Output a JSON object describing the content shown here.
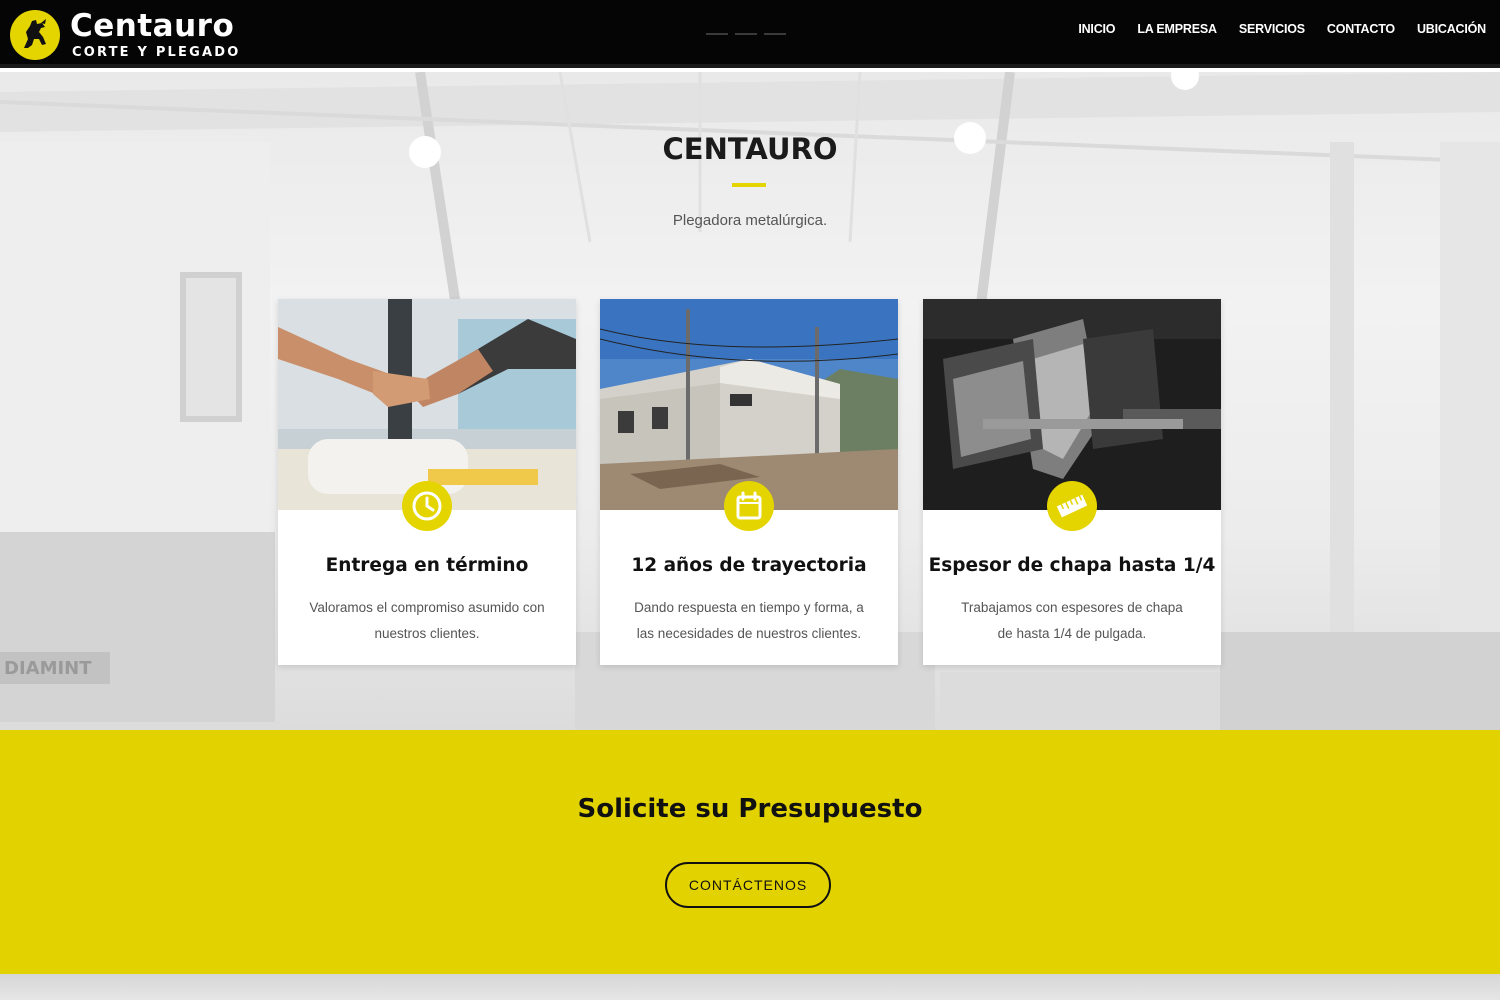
{
  "header": {
    "brand": "Centauro",
    "tagline": "CORTE Y PLEGADO",
    "nav": [
      "INICIO",
      "LA EMPRESA",
      "SERVICIOS",
      "CONTACTO",
      "UBICACIÓN"
    ]
  },
  "hero": {
    "title": "CENTAURO",
    "subtitle": "Plegadora metalúrgica.",
    "bg_watermark": "DIAMINT"
  },
  "features": [
    {
      "icon": "clock-icon",
      "title": "Entrega en término",
      "text": "Valoramos el compromiso asumido con nuestros clientes."
    },
    {
      "icon": "calendar-icon",
      "title": "12 años de trayectoria",
      "text": "Dando respuesta en tiempo y forma, a las necesidades de nuestros clientes."
    },
    {
      "icon": "ruler-icon",
      "title": "Espesor de chapa hasta 1/4",
      "text": "Trabajamos con espesores de chapa de hasta 1/4 de pulgada."
    }
  ],
  "cta": {
    "title": "Solicite su Presupuesto",
    "button": "CONTÁCTENOS"
  },
  "colors": {
    "accent": "#e4d400",
    "cta_bg": "#e2d300",
    "header_bg": "#050505",
    "text_dark": "#111111"
  }
}
